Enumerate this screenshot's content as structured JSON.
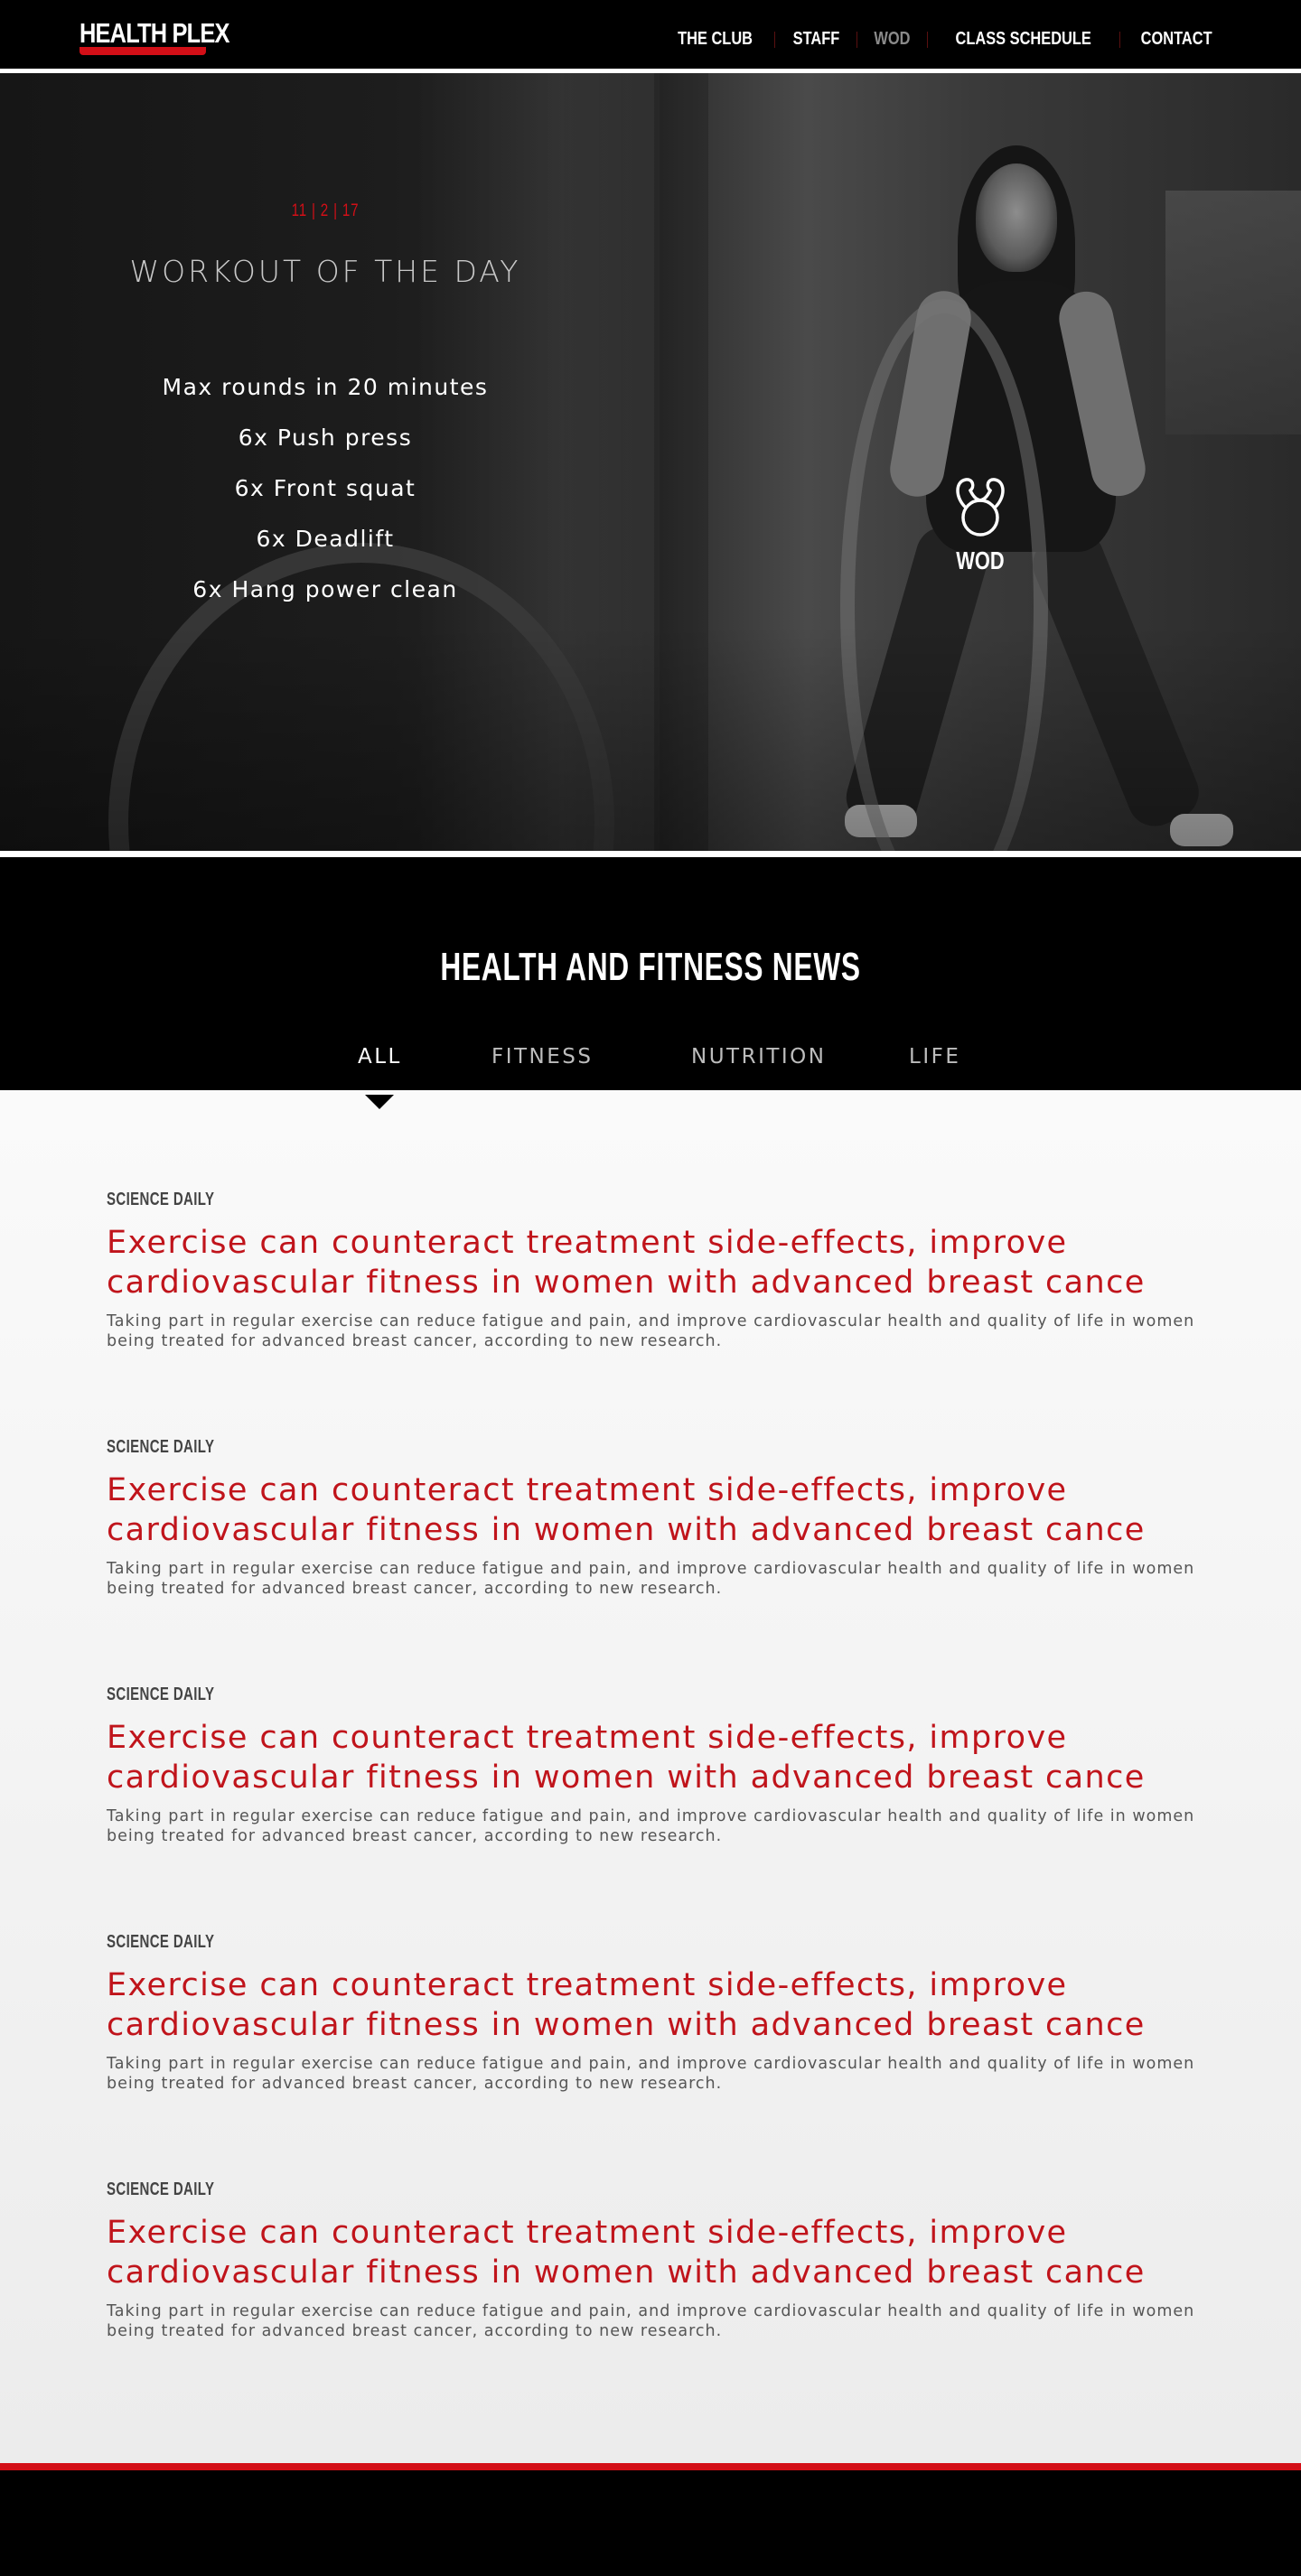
{
  "brand": {
    "name": "HEALTH PLEX",
    "accent": "#d30f17"
  },
  "nav": {
    "items": [
      {
        "label": "THE CLUB",
        "active": false
      },
      {
        "label": "STAFF",
        "active": false
      },
      {
        "label": "WOD",
        "active": true
      },
      {
        "label": "CLASS SCHEDULE",
        "active": false
      },
      {
        "label": "CONTACT",
        "active": false
      }
    ]
  },
  "wod": {
    "date": "11 | 2 | 17",
    "title": "WORKOUT OF THE DAY",
    "items": [
      "Max rounds in 20 minutes",
      "6x Push press",
      "6x Front squat",
      "6x Deadlift",
      "6x Hang power clean"
    ],
    "badge_icon": "kettlebell-icon",
    "badge_label": "WOD"
  },
  "news": {
    "title": "HEALTH AND FITNESS NEWS",
    "tabs": [
      {
        "label": "ALL",
        "active": true
      },
      {
        "label": "FITNESS",
        "active": false
      },
      {
        "label": "NUTRITION",
        "active": false
      },
      {
        "label": "LIFE",
        "active": false
      }
    ],
    "articles": [
      {
        "source": "SCIENCE DAILY",
        "title_line1": "Exercise can counteract treatment side-effects, improve",
        "title_line2": "cardiovascular fitness in women with advanced breast cance",
        "excerpt": "Taking part in regular exercise can reduce fatigue and pain, and improve cardiovascular health and quality of life in women being treated for advanced breast cancer, according to new research."
      },
      {
        "source": "SCIENCE DAILY",
        "title_line1": "Exercise can counteract treatment side-effects, improve",
        "title_line2": "cardiovascular fitness in women with advanced breast cance",
        "excerpt": "Taking part in regular exercise can reduce fatigue and pain, and improve cardiovascular health and quality of life in women being treated for advanced breast cancer, according to new research."
      },
      {
        "source": "SCIENCE DAILY",
        "title_line1": "Exercise can counteract treatment side-effects, improve",
        "title_line2": "cardiovascular fitness in women with advanced breast cance",
        "excerpt": "Taking part in regular exercise can reduce fatigue and pain, and improve cardiovascular health and quality of life in women being treated for advanced breast cancer, according to new research."
      },
      {
        "source": "SCIENCE DAILY",
        "title_line1": "Exercise can counteract treatment side-effects, improve",
        "title_line2": "cardiovascular fitness in women with advanced breast cance",
        "excerpt": "Taking part in regular exercise can reduce fatigue and pain, and improve cardiovascular health and quality of life in women being treated for advanced breast cancer, according to new research."
      },
      {
        "source": "SCIENCE DAILY",
        "title_line1": "Exercise can counteract treatment side-effects, improve",
        "title_line2": "cardiovascular fitness in women with advanced breast cance",
        "excerpt": "Taking part in regular exercise can reduce fatigue and pain, and improve cardiovascular health and quality of life in women being treated for advanced breast cancer, according to new research."
      }
    ]
  }
}
